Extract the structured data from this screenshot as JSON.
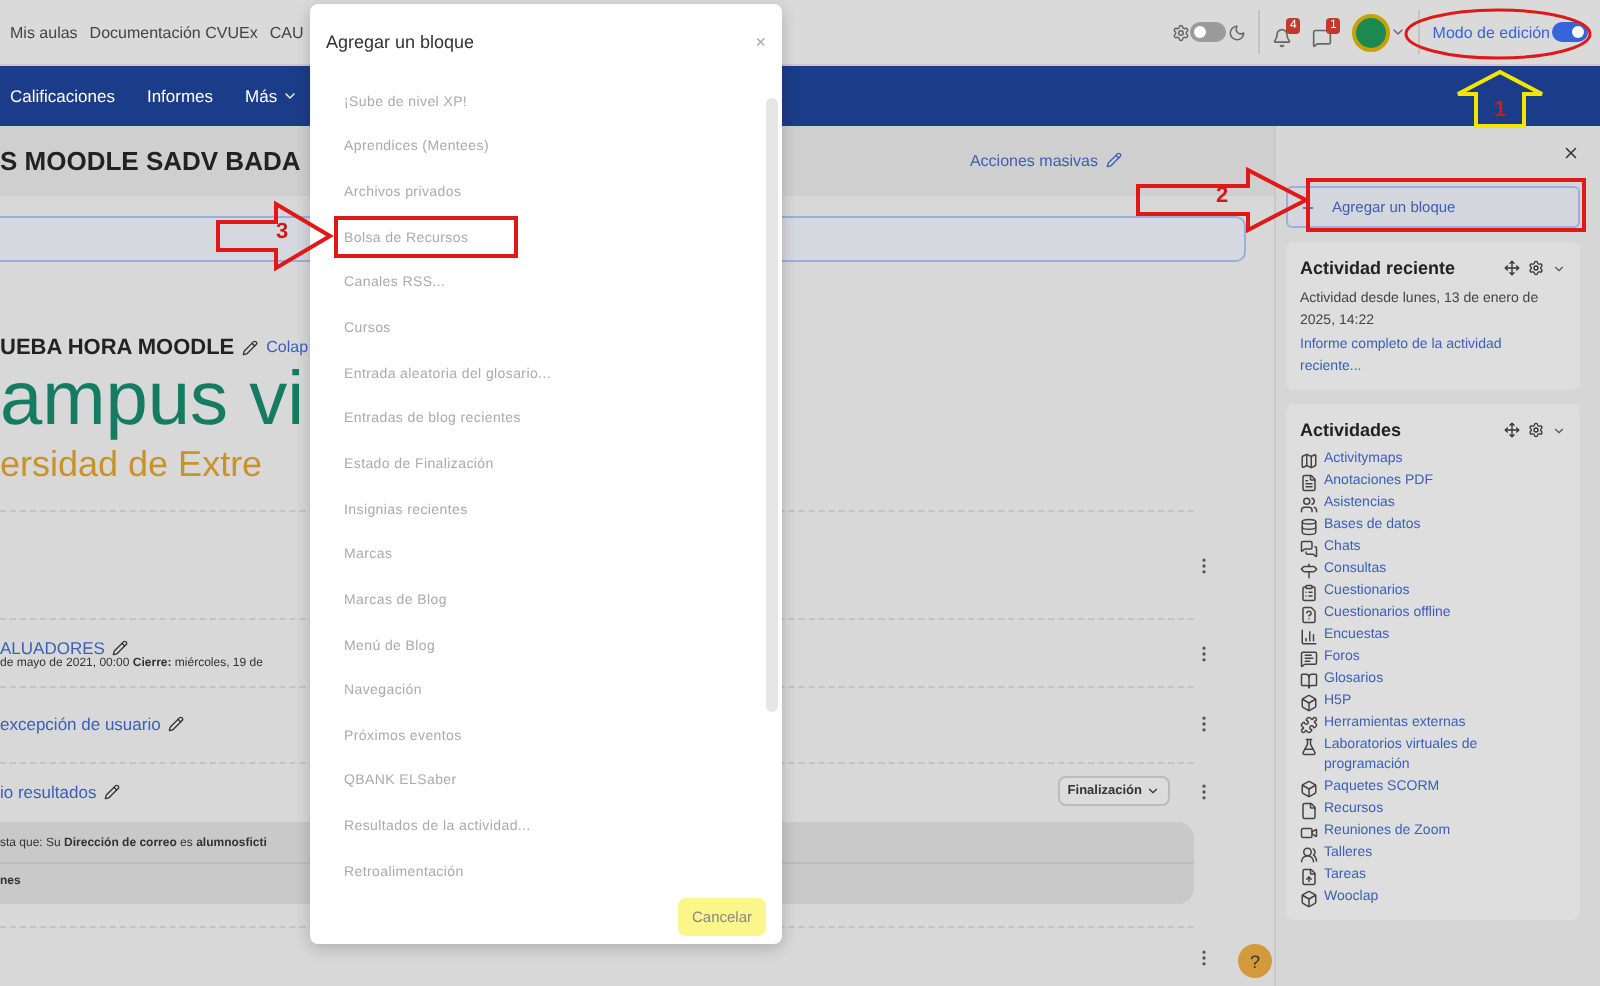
{
  "top_nav": {
    "links": [
      "Mis aulas",
      "Documentación CVUEx",
      "CAU"
    ],
    "dark_mode_on": false,
    "notifications_badge": "4",
    "messages_badge": "1",
    "edit_mode": {
      "label": "Modo de edición",
      "on": true
    }
  },
  "course_nav": {
    "items": [
      "Calificaciones",
      "Informes",
      "Más"
    ]
  },
  "course": {
    "title": "S MOODLE SADV BADA",
    "bulk_action": "Acciones masivas",
    "section_title": "UEBA HORA MOODLE",
    "collapse_link": "Colap",
    "logo_line_1": "ampus vi",
    "logo_line_2": "ersidad de Extre",
    "activities": [
      {
        "kind": "empty"
      },
      {
        "kind": "assignment",
        "name": "ALUADORES",
        "dates": "de mayo de 2021, 00:00 **Cierre:** miércoles, 19 de"
      },
      {
        "kind": "link",
        "name": "excepción de usuario"
      },
      {
        "kind": "restricted",
        "name": "io resultados",
        "completion": "Finalización",
        "restriction": "sta que: Su **Dirección de correo** es **alumnosficti**",
        "restriction_2": "nes"
      },
      {
        "kind": "empty"
      }
    ],
    "help": "?"
  },
  "drawer": {
    "add_block": "Agregar un bloque",
    "blocks": [
      {
        "kind": "recent",
        "title": "Actividad reciente",
        "text": "Actividad desde lunes, 13 de enero de 2025, 14:22",
        "link": "Informe completo de la actividad reciente..."
      },
      {
        "kind": "list",
        "title": "Actividades",
        "items": [
          "Activitymaps",
          "Anotaciones PDF",
          "Asistencias",
          "Bases de datos",
          "Chats",
          "Consultas",
          "Cuestionarios",
          "Cuestionarios offline",
          "Encuestas",
          "Foros",
          "Glosarios",
          "H5P",
          "Herramientas externas",
          "Laboratorios virtuales de programación",
          "Paquetes SCORM",
          "Recursos",
          "Reuniones de Zoom",
          "Talleres",
          "Tareas",
          "Wooclap"
        ]
      }
    ]
  },
  "modal": {
    "title": "Agregar un bloque",
    "close": "×",
    "items": [
      "¡Sube de nivel XP!",
      "Aprendices (Mentees)",
      "Archivos privados",
      "Bolsa de Recursos",
      "Canales RSS...",
      "Cursos",
      "Entrada aleatoria del glosario...",
      "Entradas de blog recientes",
      "Estado de Finalización",
      "Insignias recientes",
      "Marcas",
      "Marcas de Blog",
      "Menú de Blog",
      "Navegación",
      "Próximos eventos",
      "QBANK ELSaber",
      "Resultados de la actividad...",
      "Retroalimentación"
    ],
    "cancel": "Cancelar"
  },
  "annotations": [
    {
      "label": "1"
    },
    {
      "label": "2"
    },
    {
      "label": "3"
    }
  ]
}
